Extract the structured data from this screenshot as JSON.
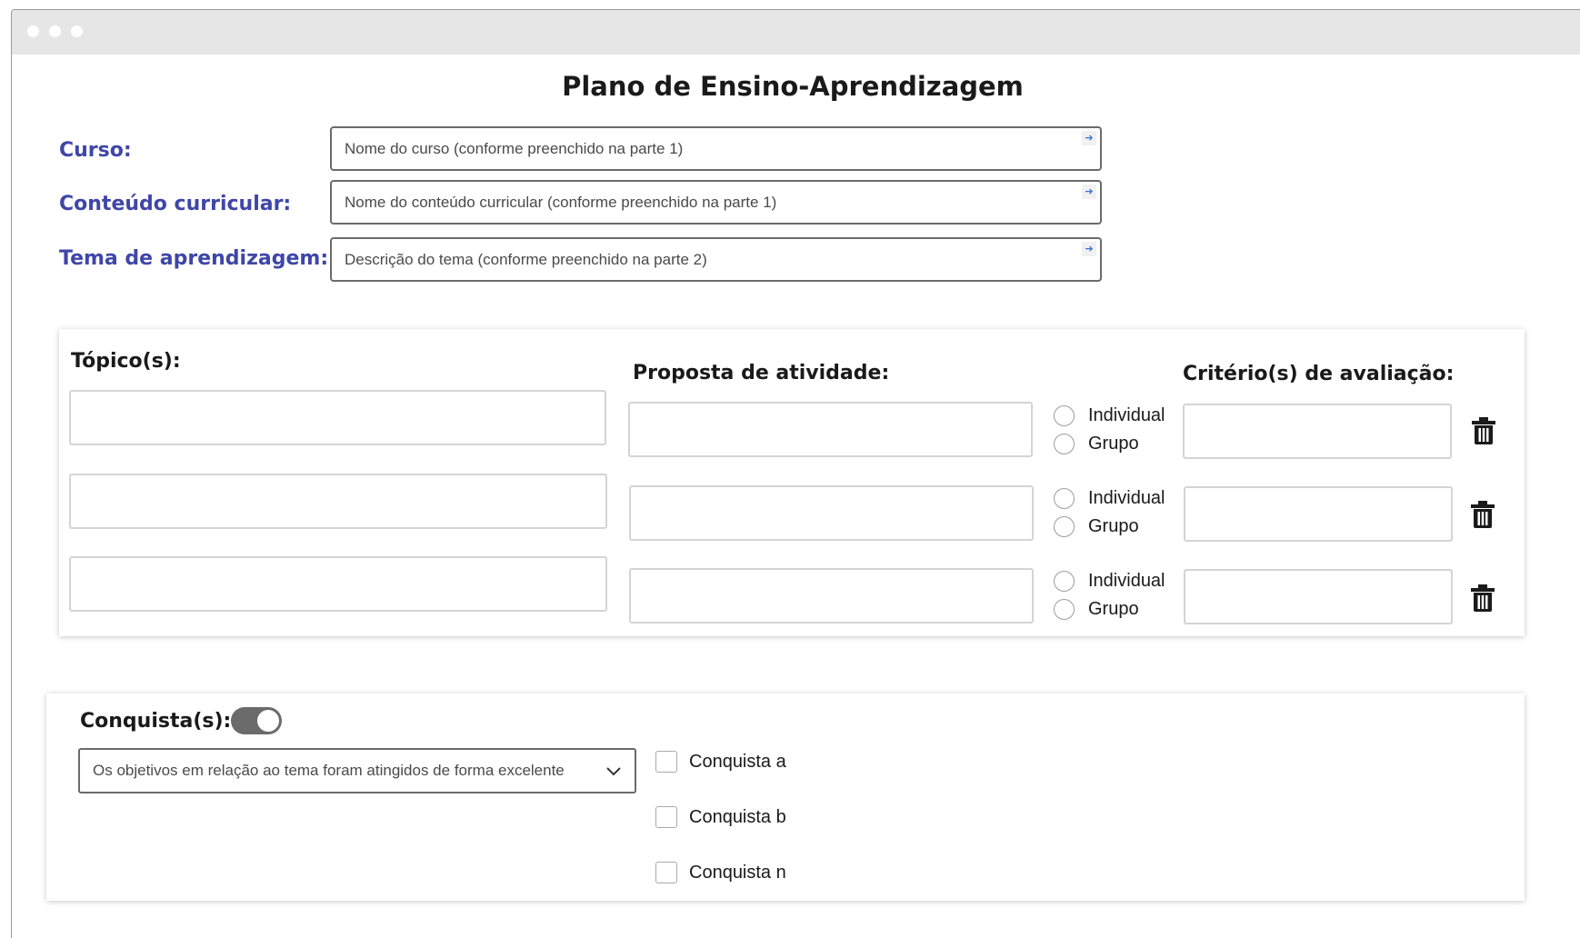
{
  "page": {
    "title": "Plano de Ensino-Aprendizagem"
  },
  "header_fields": [
    {
      "label": "Curso:",
      "placeholder": "Nome do curso (conforme preenchido na parte 1)"
    },
    {
      "label": "Conteúdo curricular:",
      "placeholder": "Nome do conteúdo curricular (conforme preenchido na parte 1)"
    },
    {
      "label": "Tema de aprendizagem:",
      "placeholder": "Descrição do tema (conforme preenchido na parte 2)"
    }
  ],
  "field_icon": "arrow-right-icon",
  "activities": {
    "topics_heading": "Tópico(s):",
    "proposal_heading": "Proposta de atividade:",
    "criteria_heading": "Critério(s) de avaliação:",
    "radio_options": [
      "Individual",
      "Grupo"
    ],
    "rows": [
      {
        "topic": "",
        "proposal": "",
        "criteria": ""
      },
      {
        "topic": "",
        "proposal": "",
        "criteria": ""
      },
      {
        "topic": "",
        "proposal": "",
        "criteria": ""
      }
    ],
    "delete_icon": "trash-icon"
  },
  "achievements": {
    "heading": "Conquista(s):",
    "toggle_on": true,
    "select_value": "Os objetivos em relação ao tema foram atingidos de forma excelente",
    "checkboxes": [
      {
        "label": "Conquista a",
        "checked": false
      },
      {
        "label": "Conquista b",
        "checked": false
      },
      {
        "label": "Conquista n",
        "checked": false
      }
    ]
  },
  "colors": {
    "label_blue": "#3f46a8",
    "titlebar": "#e6e6e6",
    "toggle_on": "#6b6b6b",
    "icon_dark": "#1a1a1a",
    "field_arrow": "#3b6fd1"
  }
}
